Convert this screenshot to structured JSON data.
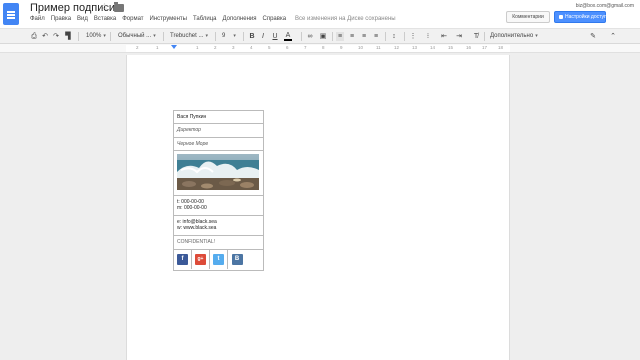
{
  "header": {
    "title": "Пример подписи",
    "account_email": "biz@box.com@gmail.com",
    "comments_label": "Комментарии",
    "share_label": "Настройки доступа",
    "saved_status": "Все изменения на Диске сохранены"
  },
  "menu": [
    "Файл",
    "Правка",
    "Вид",
    "Вставка",
    "Формат",
    "Инструменты",
    "Таблица",
    "Дополнения",
    "Справка"
  ],
  "toolbar": {
    "zoom": "100%",
    "style": "Обычный ...",
    "font": "Trebuchet ...",
    "size": "9",
    "more": "Дополнительно"
  },
  "ruler": {
    "numbers": [
      "2",
      "1",
      "1",
      "2",
      "3",
      "4",
      "5",
      "6",
      "7",
      "8",
      "9",
      "10",
      "11",
      "12",
      "13",
      "14",
      "15",
      "16",
      "17",
      "18"
    ]
  },
  "signature": {
    "name": "Вася Пупкин",
    "role": "Директор",
    "location": "Черное Море",
    "phone": "t: 000-00-00",
    "mobile": "m: 000-00-00",
    "email": "e: info@black.sea",
    "web": "w: www.black.sea",
    "confidential": "CONFIDENTIAL!",
    "social": [
      {
        "icon": "facebook-icon",
        "letter": "f",
        "color": "#3b5998"
      },
      {
        "icon": "google-plus-icon",
        "letter": "g+",
        "color": "#dd4b39"
      },
      {
        "icon": "twitter-icon",
        "letter": "t",
        "color": "#55acee"
      },
      {
        "icon": "vk-icon",
        "letter": "В",
        "color": "#4c75a3"
      }
    ]
  },
  "colors": {
    "accent": "#4285f4",
    "share_button": "#4d90fe"
  }
}
